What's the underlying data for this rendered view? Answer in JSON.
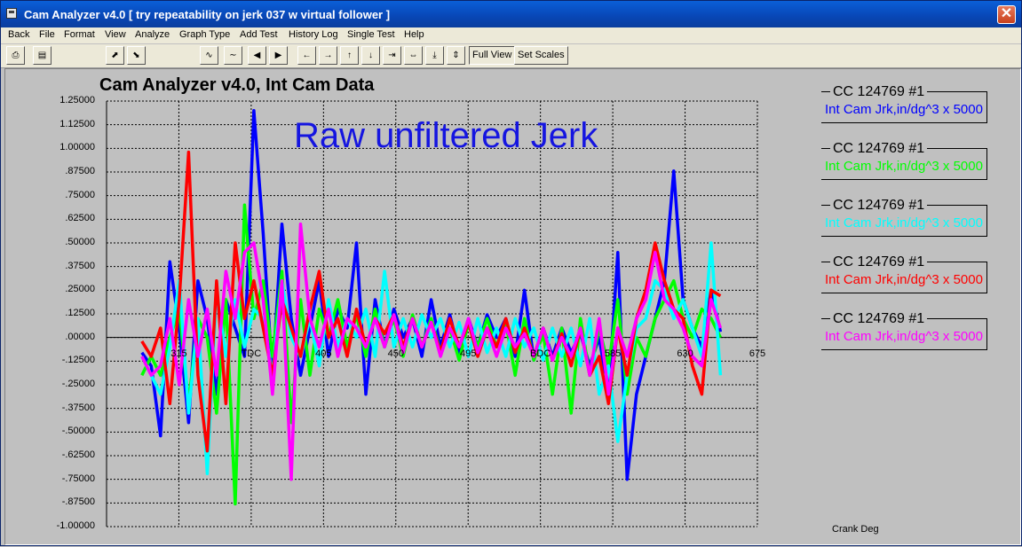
{
  "window": {
    "title": "Cam Analyzer v4.0  [ try repeatability on jerk 037 w virtual follower ]",
    "close_glyph": "✕"
  },
  "menu": [
    "Back",
    "File",
    "Format",
    "View",
    "Analyze",
    "Graph Type",
    "Add Test",
    "History Log",
    "Single Test",
    "Help"
  ],
  "toolbar": {
    "full_view": "Full View",
    "set_scales": "Set Scales"
  },
  "colors": {
    "blue": "#0000ff",
    "green": "#00ff00",
    "cyan": "#00ffff",
    "red": "#ff0000",
    "magenta": "#ff00ff"
  },
  "chart_data": {
    "type": "line",
    "title": "Cam Analyzer v4.0,   Int Cam Data",
    "annotation": "Raw unfiltered Jerk",
    "xlabel": "Crank Deg",
    "xlim": [
      270,
      675
    ],
    "ylim": [
      -1.0,
      1.25
    ],
    "y_ticks": [
      "1.25000",
      "1.12500",
      "1.00000",
      ".87500",
      ".75000",
      ".62500",
      ".50000",
      ".37500",
      ".25000",
      ".12500",
      ".00000",
      "-.12500",
      "-.25000",
      "-.37500",
      "-.50000",
      "-.62500",
      "-.75000",
      "-.87500",
      "-1.00000"
    ],
    "x_ticks": [
      "315",
      "TDC",
      "405",
      "450",
      "495",
      "BDC",
      "585",
      "630",
      "675"
    ],
    "grid": true,
    "legend_placement": "right",
    "series": [
      {
        "name": "Int Cam Jrk,in/dg^3 x 5000",
        "label": "CC 124769 #1",
        "color": "#0000ff",
        "values": [
          -0.08,
          -0.15,
          -0.52,
          0.4,
          0.05,
          -0.45,
          0.3,
          0.1,
          -0.3,
          0.2,
          0.05,
          -0.1,
          1.2,
          0.55,
          -0.2,
          0.6,
          0.1,
          -0.2,
          0.05,
          0.3,
          -0.1,
          0.15,
          0.05,
          0.5,
          -0.3,
          0.2,
          -0.05,
          0.15,
          0.0,
          0.1,
          -0.1,
          0.2,
          -0.05,
          0.12,
          -0.08,
          0.1,
          -0.05,
          0.12,
          0.0,
          0.1,
          -0.1,
          0.25,
          -0.12,
          0.05,
          -0.1,
          0.05,
          -0.08,
          0.02,
          -0.15,
          0.0,
          -0.3,
          0.45,
          -0.75,
          -0.3,
          -0.1,
          0.1,
          0.3,
          0.88,
          0.2,
          0.05,
          -0.05,
          0.25,
          0.03
        ]
      },
      {
        "name": "Int Cam Jrk,in/dg^3 x 5000",
        "label": "CC 124769 #1",
        "color": "#00ff00",
        "values": [
          -0.2,
          -0.1,
          -0.2,
          0.0,
          0.15,
          -0.35,
          0.1,
          0.0,
          -0.4,
          0.2,
          -0.88,
          0.7,
          0.1,
          0.3,
          -0.1,
          0.35,
          -0.45,
          0.2,
          -0.2,
          0.15,
          0.0,
          0.2,
          -0.05,
          0.12,
          -0.1,
          0.15,
          -0.05,
          0.1,
          -0.1,
          0.12,
          -0.05,
          0.1,
          -0.08,
          0.05,
          -0.12,
          0.08,
          -0.05,
          0.1,
          -0.05,
          0.08,
          -0.2,
          0.1,
          -0.12,
          0.02,
          -0.3,
          0.05,
          -0.4,
          0.1,
          -0.2,
          0.05,
          -0.15,
          0.2,
          -0.3,
          0.0,
          -0.1,
          0.1,
          0.2,
          0.3,
          0.1,
          0.0,
          0.15,
          0.1,
          0.0
        ]
      },
      {
        "name": "Int Cam Jrk,in/dg^3 x 5000",
        "label": "CC 124769 #1",
        "color": "#00ffff",
        "values": [
          -0.1,
          -0.2,
          -0.3,
          -0.05,
          0.3,
          -0.4,
          0.1,
          -0.72,
          0.25,
          -0.1,
          0.2,
          -0.05,
          0.15,
          0.1,
          -0.2,
          0.3,
          0.0,
          -0.1,
          0.1,
          -0.15,
          0.2,
          -0.05,
          0.1,
          0.0,
          0.15,
          -0.1,
          0.35,
          -0.05,
          0.1,
          -0.05,
          0.12,
          0.0,
          0.1,
          -0.05,
          0.08,
          -0.1,
          0.1,
          -0.08,
          0.05,
          -0.1,
          0.1,
          -0.05,
          0.05,
          -0.12,
          0.05,
          -0.1,
          0.05,
          -0.15,
          0.1,
          -0.3,
          -0.15,
          -0.55,
          -0.2,
          0.05,
          0.1,
          0.3,
          0.25,
          0.1,
          0.2,
          0.05,
          -0.1,
          0.5,
          -0.2
        ]
      },
      {
        "name": "Int Cam Jrk,in/dg^3 x 5000",
        "label": "CC 124769 #1",
        "color": "#ff0000",
        "values": [
          -0.02,
          -0.1,
          0.05,
          -0.35,
          0.2,
          0.98,
          -0.2,
          -0.6,
          0.3,
          -0.35,
          0.5,
          0.1,
          0.3,
          0.05,
          -0.2,
          0.2,
          0.05,
          -0.1,
          0.15,
          0.35,
          0.0,
          0.1,
          -0.1,
          0.15,
          -0.05,
          0.1,
          0.02,
          0.12,
          -0.05,
          0.1,
          -0.05,
          0.08,
          -0.08,
          0.1,
          -0.05,
          0.08,
          -0.1,
          0.05,
          -0.05,
          0.1,
          -0.08,
          0.05,
          -0.1,
          0.05,
          -0.12,
          0.02,
          -0.15,
          0.05,
          -0.2,
          -0.1,
          -0.35,
          0.05,
          -0.2,
          0.1,
          0.25,
          0.5,
          0.3,
          0.15,
          0.1,
          -0.15,
          -0.3,
          0.25,
          0.22
        ]
      },
      {
        "name": "Int Cam Jrk,in/dg^3 x 5000",
        "label": "CC 124769 #1",
        "color": "#ff00ff",
        "values": [
          -0.1,
          -0.2,
          -0.15,
          0.1,
          -0.25,
          0.2,
          -0.1,
          0.15,
          -0.2,
          0.35,
          0.1,
          0.45,
          0.5,
          0.2,
          -0.3,
          0.3,
          -0.75,
          0.6,
          0.1,
          -0.05,
          0.15,
          -0.1,
          0.1,
          0.05,
          -0.05,
          0.1,
          -0.05,
          0.12,
          -0.08,
          0.1,
          -0.05,
          0.08,
          -0.1,
          0.05,
          -0.05,
          0.1,
          -0.08,
          0.05,
          -0.1,
          0.05,
          -0.05,
          0.02,
          -0.1,
          0.05,
          -0.12,
          0.0,
          -0.1,
          0.05,
          -0.2,
          0.1,
          -0.3,
          0.05,
          -0.1,
          0.1,
          0.2,
          0.45,
          0.2,
          0.15,
          0.05,
          -0.1,
          -0.15,
          0.2,
          0.05
        ]
      }
    ]
  }
}
